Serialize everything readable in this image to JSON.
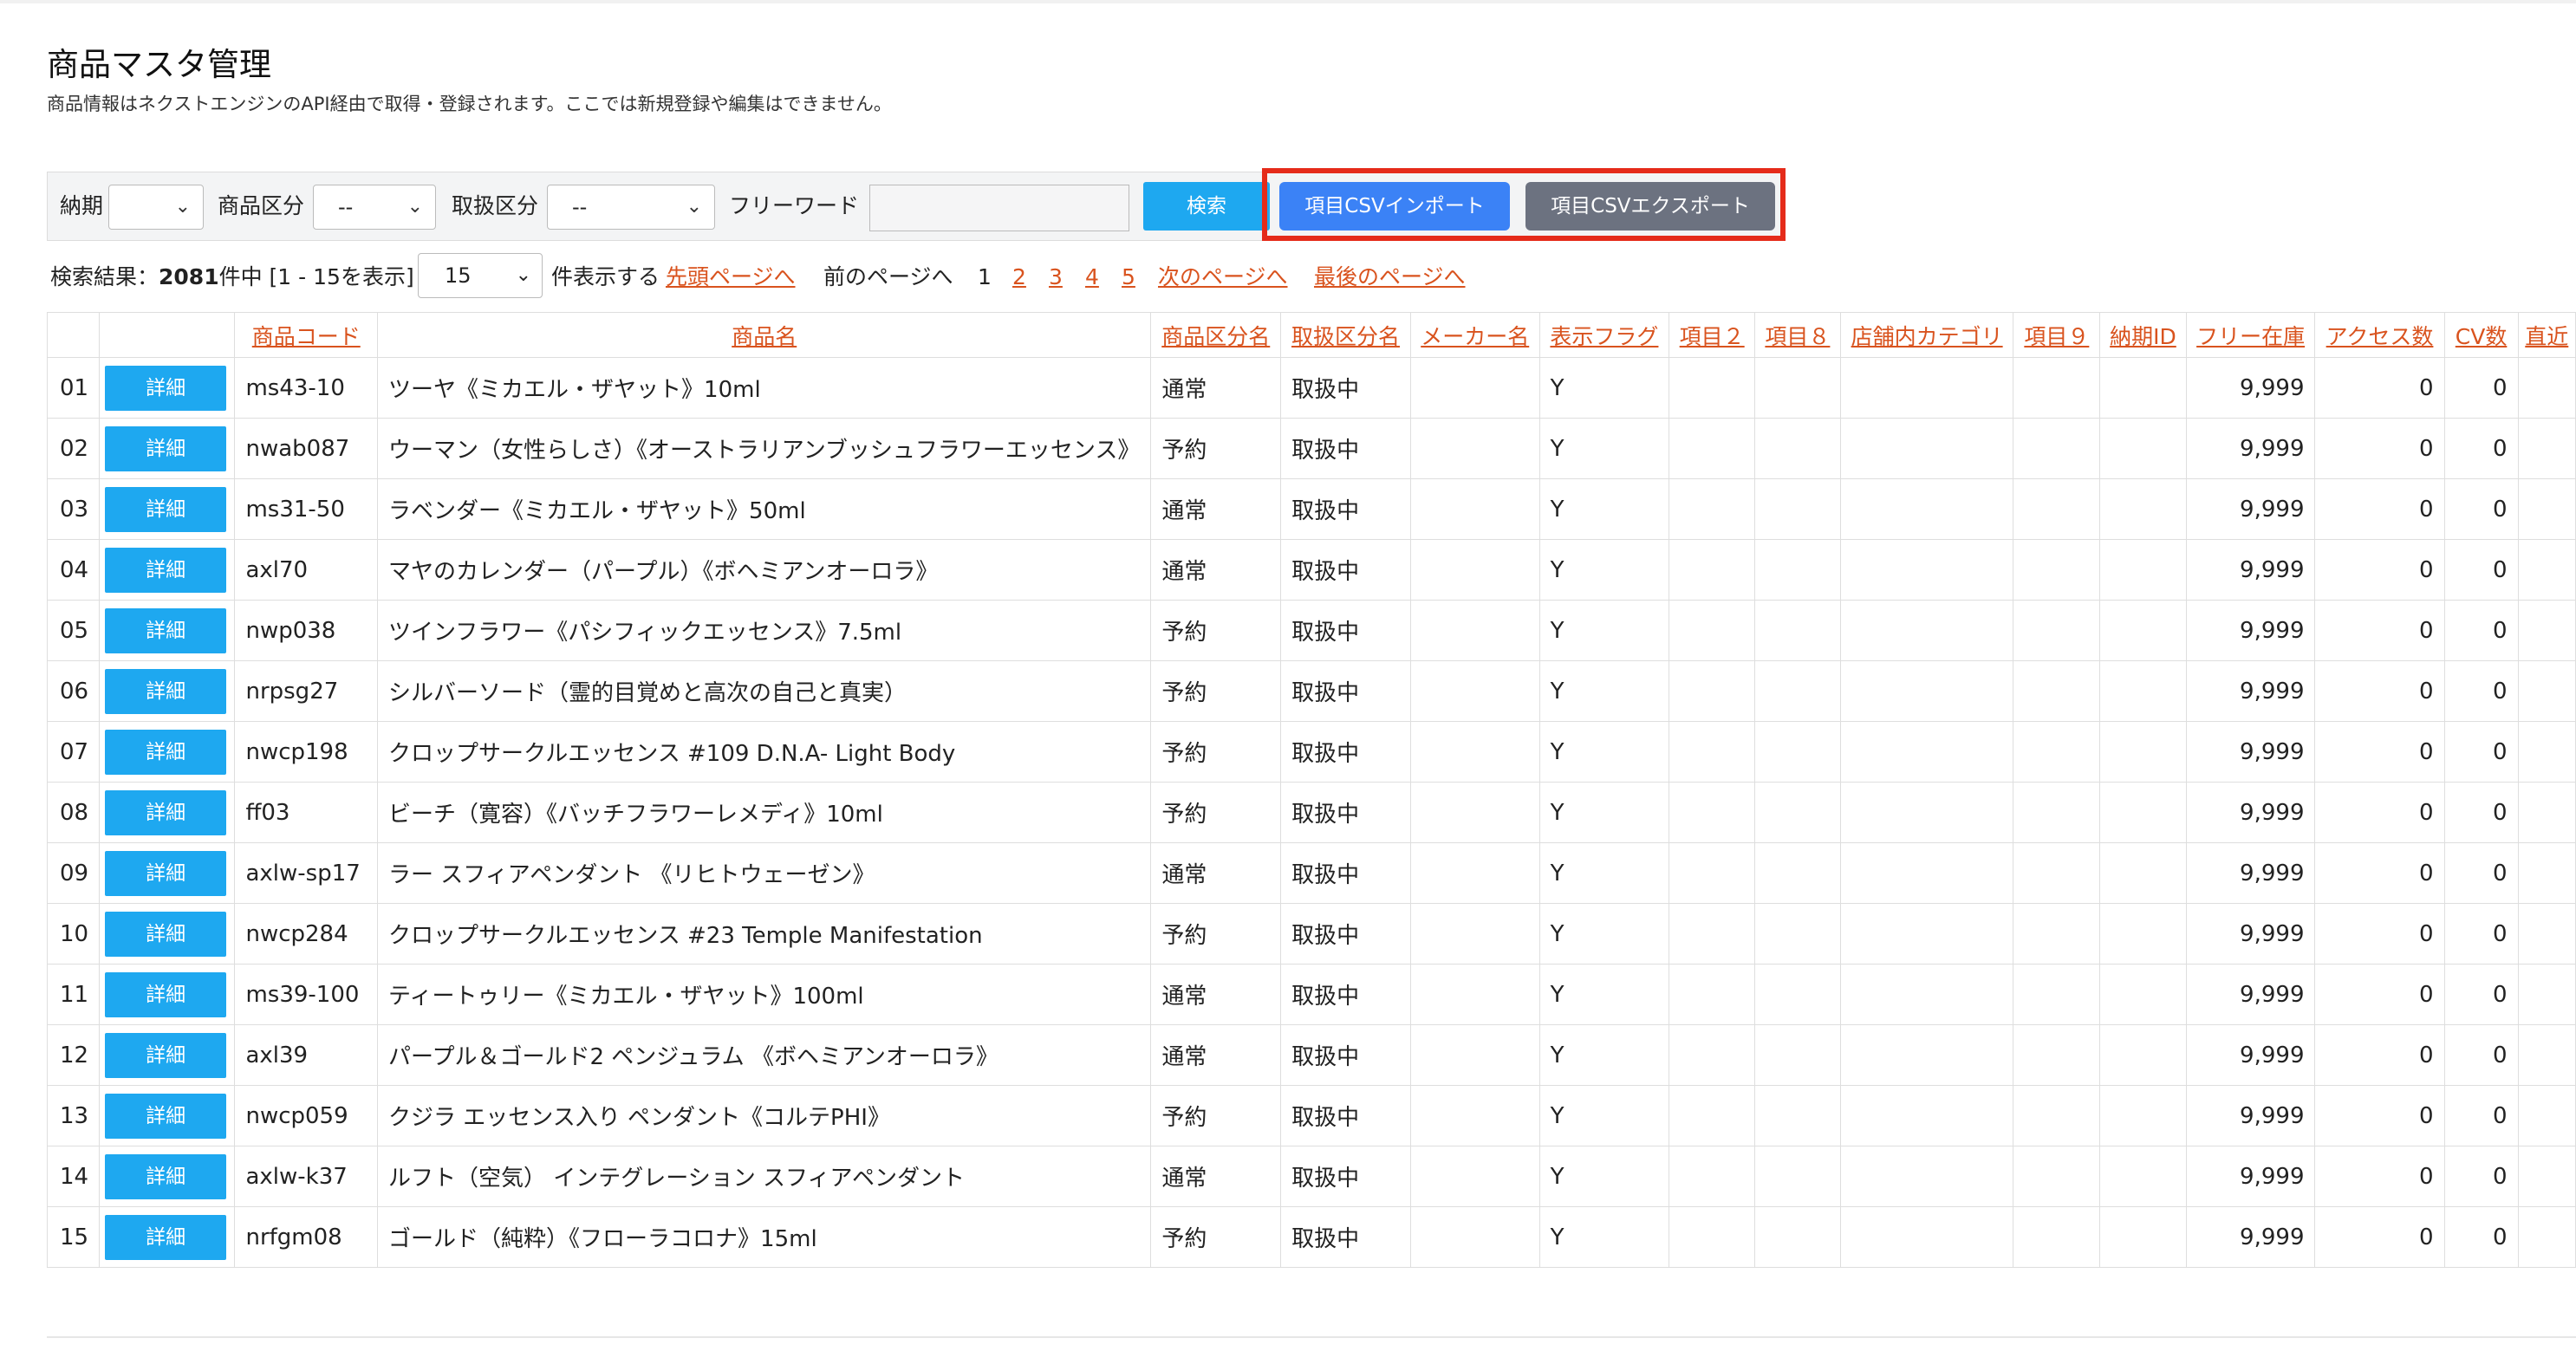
{
  "page": {
    "title": "商品マスタ管理",
    "subtitle": "商品情報はネクストエンジンのAPI経由で取得・登録されます。ここでは新規登録や編集はできません。"
  },
  "filters": {
    "nouki_label": "納期",
    "nouki_value": "",
    "shohin_kubun_label": "商品区分",
    "shohin_kubun_value": "--",
    "toriatsukai_kubun_label": "取扱区分",
    "toriatsukai_kubun_value": "--",
    "freeword_label": "フリーワード",
    "freeword_value": "",
    "search_button": "検索",
    "import_button": "項目CSVインポート",
    "export_button": "項目CSVエクスポート"
  },
  "results": {
    "prefix": "検索結果：",
    "count": "2081",
    "suffix": "件中 [1 - 15を表示]",
    "per_page": "15",
    "per_page_label": "件表示する",
    "first_page": "先頭ページへ",
    "prev_page": "前のページへ",
    "pages": [
      "1",
      "2",
      "3",
      "4",
      "5"
    ],
    "current_page": "1",
    "next_page": "次のページへ",
    "last_page": "最後のページへ"
  },
  "table": {
    "detail_label": "詳細",
    "headers": [
      "",
      "",
      "商品コード",
      "商品名",
      "商品区分名",
      "取扱区分名",
      "メーカー名",
      "表示フラグ",
      "項目２",
      "項目８",
      "店舗内カテゴリ",
      "項目９",
      "納期ID",
      "フリー在庫",
      "アクセス数",
      "CV数",
      "直近"
    ],
    "rows": [
      {
        "no": "01",
        "code": "ms43-10",
        "name": "ツーヤ《ミカエル・ザヤット》10ml",
        "kubun": "通常",
        "toriatsukai": "取扱中",
        "maker": "",
        "flag": "Y",
        "stock": "9,999",
        "access": "0",
        "cv": "0"
      },
      {
        "no": "02",
        "code": "nwab087",
        "name": "ウーマン（女性らしさ）《オーストラリアンブッシュフラワーエッセンス》",
        "kubun": "予約",
        "toriatsukai": "取扱中",
        "maker": "",
        "flag": "Y",
        "stock": "9,999",
        "access": "0",
        "cv": "0"
      },
      {
        "no": "03",
        "code": "ms31-50",
        "name": "ラベンダー《ミカエル・ザヤット》50ml",
        "kubun": "通常",
        "toriatsukai": "取扱中",
        "maker": "",
        "flag": "Y",
        "stock": "9,999",
        "access": "0",
        "cv": "0"
      },
      {
        "no": "04",
        "code": "axl70",
        "name": "マヤのカレンダー（パープル）《ボヘミアンオーロラ》",
        "kubun": "通常",
        "toriatsukai": "取扱中",
        "maker": "",
        "flag": "Y",
        "stock": "9,999",
        "access": "0",
        "cv": "0"
      },
      {
        "no": "05",
        "code": "nwp038",
        "name": "ツインフラワー《パシフィックエッセンス》7.5ml",
        "kubun": "予約",
        "toriatsukai": "取扱中",
        "maker": "",
        "flag": "Y",
        "stock": "9,999",
        "access": "0",
        "cv": "0"
      },
      {
        "no": "06",
        "code": "nrpsg27",
        "name": "シルバーソード（霊的目覚めと高次の自己と真実）",
        "kubun": "予約",
        "toriatsukai": "取扱中",
        "maker": "",
        "flag": "Y",
        "stock": "9,999",
        "access": "0",
        "cv": "0"
      },
      {
        "no": "07",
        "code": "nwcp198",
        "name": "クロップサークルエッセンス #109 D.N.A- Light Body",
        "kubun": "予約",
        "toriatsukai": "取扱中",
        "maker": "",
        "flag": "Y",
        "stock": "9,999",
        "access": "0",
        "cv": "0"
      },
      {
        "no": "08",
        "code": "ff03",
        "name": "ビーチ（寛容）《バッチフラワーレメディ》10ml",
        "kubun": "予約",
        "toriatsukai": "取扱中",
        "maker": "",
        "flag": "Y",
        "stock": "9,999",
        "access": "0",
        "cv": "0"
      },
      {
        "no": "09",
        "code": "axlw-sp17",
        "name": "ラー スフィアペンダント 《リヒトウェーゼン》",
        "kubun": "通常",
        "toriatsukai": "取扱中",
        "maker": "",
        "flag": "Y",
        "stock": "9,999",
        "access": "0",
        "cv": "0"
      },
      {
        "no": "10",
        "code": "nwcp284",
        "name": "クロップサークルエッセンス #23 Temple Manifestation",
        "kubun": "予約",
        "toriatsukai": "取扱中",
        "maker": "",
        "flag": "Y",
        "stock": "9,999",
        "access": "0",
        "cv": "0"
      },
      {
        "no": "11",
        "code": "ms39-100",
        "name": "ティートゥリー《ミカエル・ザヤット》100ml",
        "kubun": "通常",
        "toriatsukai": "取扱中",
        "maker": "",
        "flag": "Y",
        "stock": "9,999",
        "access": "0",
        "cv": "0"
      },
      {
        "no": "12",
        "code": "axl39",
        "name": "パープル＆ゴールド2 ペンジュラム 《ボヘミアンオーロラ》",
        "kubun": "通常",
        "toriatsukai": "取扱中",
        "maker": "",
        "flag": "Y",
        "stock": "9,999",
        "access": "0",
        "cv": "0"
      },
      {
        "no": "13",
        "code": "nwcp059",
        "name": "クジラ エッセンス入り ペンダント《コルテPHI》",
        "kubun": "予約",
        "toriatsukai": "取扱中",
        "maker": "",
        "flag": "Y",
        "stock": "9,999",
        "access": "0",
        "cv": "0"
      },
      {
        "no": "14",
        "code": "axlw-k37",
        "name": "ルフト（空気） インテグレーション スフィアペンダント",
        "kubun": "通常",
        "toriatsukai": "取扱中",
        "maker": "",
        "flag": "Y",
        "stock": "9,999",
        "access": "0",
        "cv": "0"
      },
      {
        "no": "15",
        "code": "nrfgm08",
        "name": "ゴールド（純粋）《フローラコロナ》15ml",
        "kubun": "予約",
        "toriatsukai": "取扱中",
        "maker": "",
        "flag": "Y",
        "stock": "9,999",
        "access": "0",
        "cv": "0"
      }
    ]
  },
  "colors": {
    "primary": "#1ea8f0",
    "import": "#3b82f6",
    "export": "#6c7280",
    "link": "#d9531e",
    "highlight": "#e52b1a"
  }
}
